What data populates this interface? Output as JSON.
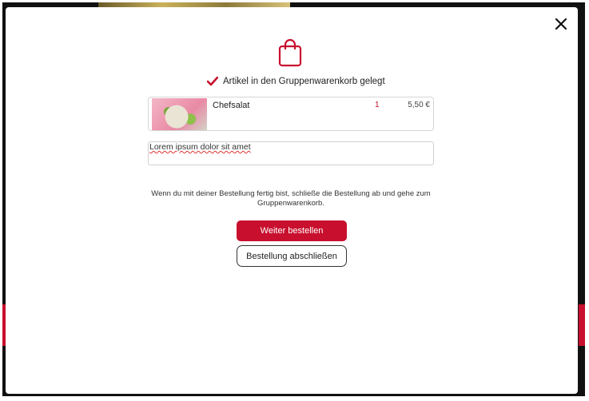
{
  "confirmation": {
    "message": "Artikel in den Gruppenwarenkorb gelegt"
  },
  "item": {
    "name": "Chefsalat",
    "quantity": "1",
    "price": "5,50 €"
  },
  "note": {
    "value": "Lorem ipsum dolor sit amet"
  },
  "info_text": "Wenn du mit deiner Bestellung fertig bist, schließe die Bestellung ab und gehe zum Gruppenwarenkorb.",
  "buttons": {
    "continue_label": "Weiter bestellen",
    "finish_label": "Bestellung abschließen"
  },
  "colors": {
    "accent": "#c8102e"
  },
  "icons": {
    "close": "close-icon",
    "bag": "shopping-bag-icon",
    "check": "checkmark-icon"
  }
}
